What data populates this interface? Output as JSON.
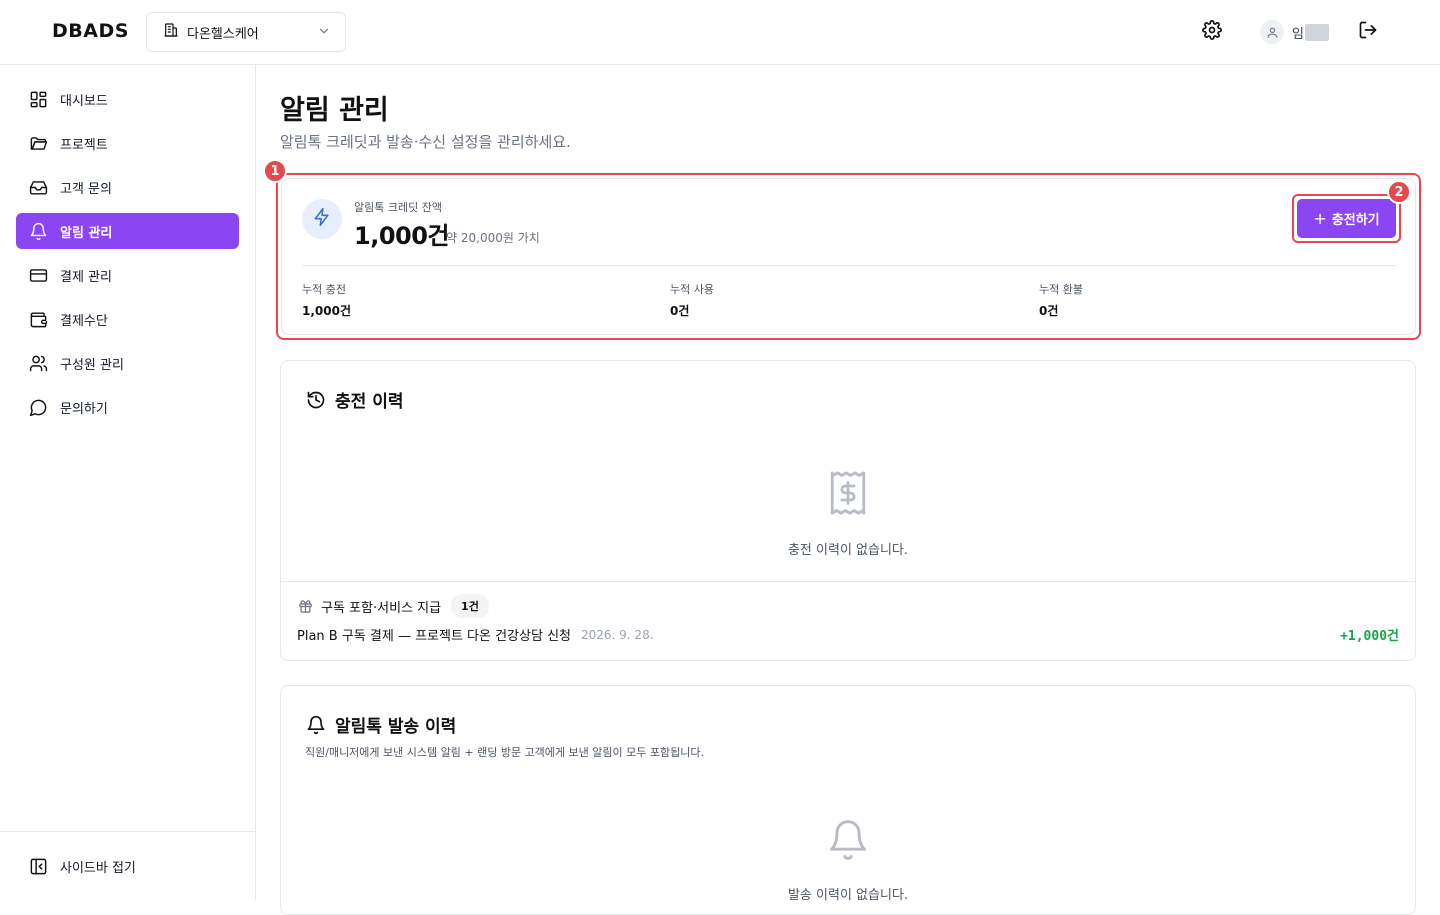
{
  "header": {
    "logo": "DBADS",
    "org_select": {
      "label": "다온헬스케어",
      "icon": "building-icon"
    },
    "settings_icon": "gear-icon",
    "user": {
      "name_visible": "임",
      "name_redacted": true
    },
    "logout_icon": "logout-icon"
  },
  "sidebar": {
    "items": [
      {
        "label": "대시보드",
        "icon": "grid-icon",
        "active": false
      },
      {
        "label": "프로젝트",
        "icon": "folder-icon",
        "active": false
      },
      {
        "label": "고객 문의",
        "icon": "inbox-icon",
        "active": false
      },
      {
        "label": "알림 관리",
        "icon": "bell-icon",
        "active": true
      },
      {
        "label": "결제 관리",
        "icon": "credit-card-icon",
        "active": false
      },
      {
        "label": "결제수단",
        "icon": "wallet-icon",
        "active": false
      },
      {
        "label": "구성원 관리",
        "icon": "users-icon",
        "active": false
      },
      {
        "label": "문의하기",
        "icon": "message-icon",
        "active": false
      }
    ],
    "collapse_label": "사이드바 접기"
  },
  "page": {
    "title": "알림 관리",
    "subtitle": "알림톡 크레딧과 발송·수신 설정을 관리하세요."
  },
  "credit": {
    "label": "알림톡 크레딧 잔액",
    "amount": "1,000건",
    "value_text": "약 20,000원 가치",
    "charge_label": "충전하기",
    "stats": [
      {
        "label": "누적 충전",
        "value": "1,000건"
      },
      {
        "label": "누적 사용",
        "value": "0건"
      },
      {
        "label": "누적 환불",
        "value": "0건"
      }
    ]
  },
  "annotations": {
    "badge1": "1",
    "badge2": "2"
  },
  "charge_history": {
    "title": "충전 이력",
    "empty_text": "충전 이력이 없습니다.",
    "subscription": {
      "label": "구독 포함·서비스 지급",
      "count": "1건",
      "row": {
        "text": "Plan B 구독 결제 — 프로젝트 다온 건강상담 신청",
        "date": "2026. 9. 28.",
        "amount": "+1,000건"
      }
    }
  },
  "send_history": {
    "title": "알림톡 발송 이력",
    "description": "직원/매니저에게 보낸 시스템 알림 + 랜딩 방문 고객에게 보낸 알림이 모두 포함됩니다.",
    "empty_text": "발송 이력이 없습니다."
  },
  "colors": {
    "accent": "#8b45f2",
    "highlight": "#e5484d",
    "positive": "#16a34a",
    "border": "#e5e7eb"
  }
}
